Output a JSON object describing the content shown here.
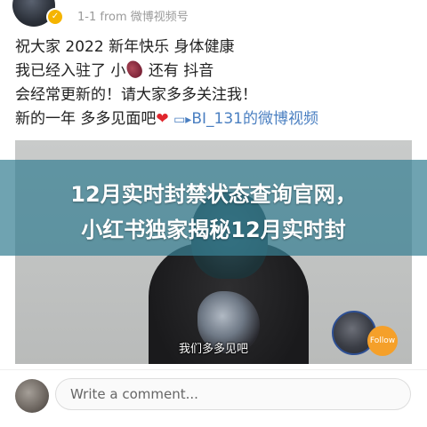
{
  "post": {
    "meta": "1-1  from 微博视频号",
    "lines": [
      "祝大家 2022 新年快乐 身体健康",
      "我已经入驻了 小",
      "还有 抖音",
      "会经常更新的！请大家多多关注我！",
      "新的一年 多多见面吧",
      "BI_131的微博视频"
    ],
    "video_caption": "我们多多见吧",
    "follow_label": "Follow"
  },
  "banner": {
    "line1": "12月实时封禁状态查询官网，",
    "line2": "小红书独家揭秘12月实时封"
  },
  "comment": {
    "placeholder": "Write a comment..."
  },
  "icons": {
    "verified": "verified-badge-icon",
    "heart": "heart-icon",
    "play": "video-play-icon"
  },
  "colors": {
    "banner": "#388093",
    "follow": "#f5a02a",
    "link": "#4a7fc1",
    "heart": "#e0262d"
  }
}
